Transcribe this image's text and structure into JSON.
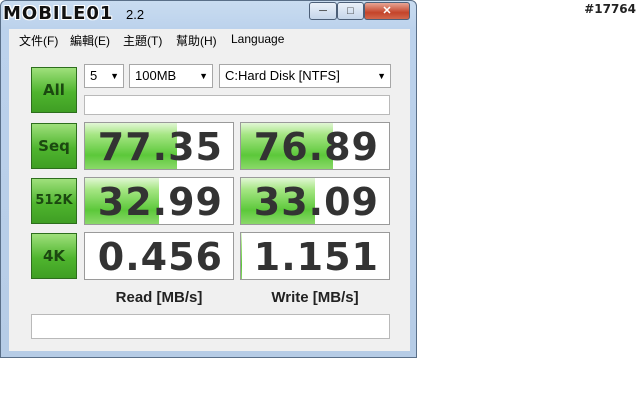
{
  "watermark": {
    "logo": "MOBILE01",
    "tag": "#17764"
  },
  "window": {
    "title_suffix": "2.2",
    "min_glyph": "─",
    "max_glyph": "□",
    "close_glyph": "✕"
  },
  "menu": {
    "items": [
      "文件(F)",
      "編輯(E)",
      "主題(T)",
      "幫助(H)",
      "Language"
    ]
  },
  "controls": {
    "all_label": "All",
    "count": {
      "value": "5",
      "arrow": "▼"
    },
    "size": {
      "value": "100MB",
      "arrow": "▼"
    },
    "drive": {
      "value": "C:Hard Disk [NTFS]",
      "arrow": "▼"
    }
  },
  "rows": [
    {
      "label": "Seq",
      "read": "77.35",
      "write": "76.89",
      "read_fill": 0.62,
      "write_fill": 0.62
    },
    {
      "label": "512K",
      "read": "32.99",
      "write": "33.09",
      "read_fill": 0.5,
      "write_fill": 0.5
    },
    {
      "label": "4K",
      "read": "0.456",
      "write": "1.151",
      "read_fill": 0.0,
      "write_fill": 0.01
    }
  ],
  "columns": {
    "read": "Read [MB/s]",
    "write": "Write [MB/s]"
  },
  "colors": {
    "accent_green": "#4fb52e",
    "frame_blue": "#b6cce6",
    "close_red": "#c4442a"
  }
}
